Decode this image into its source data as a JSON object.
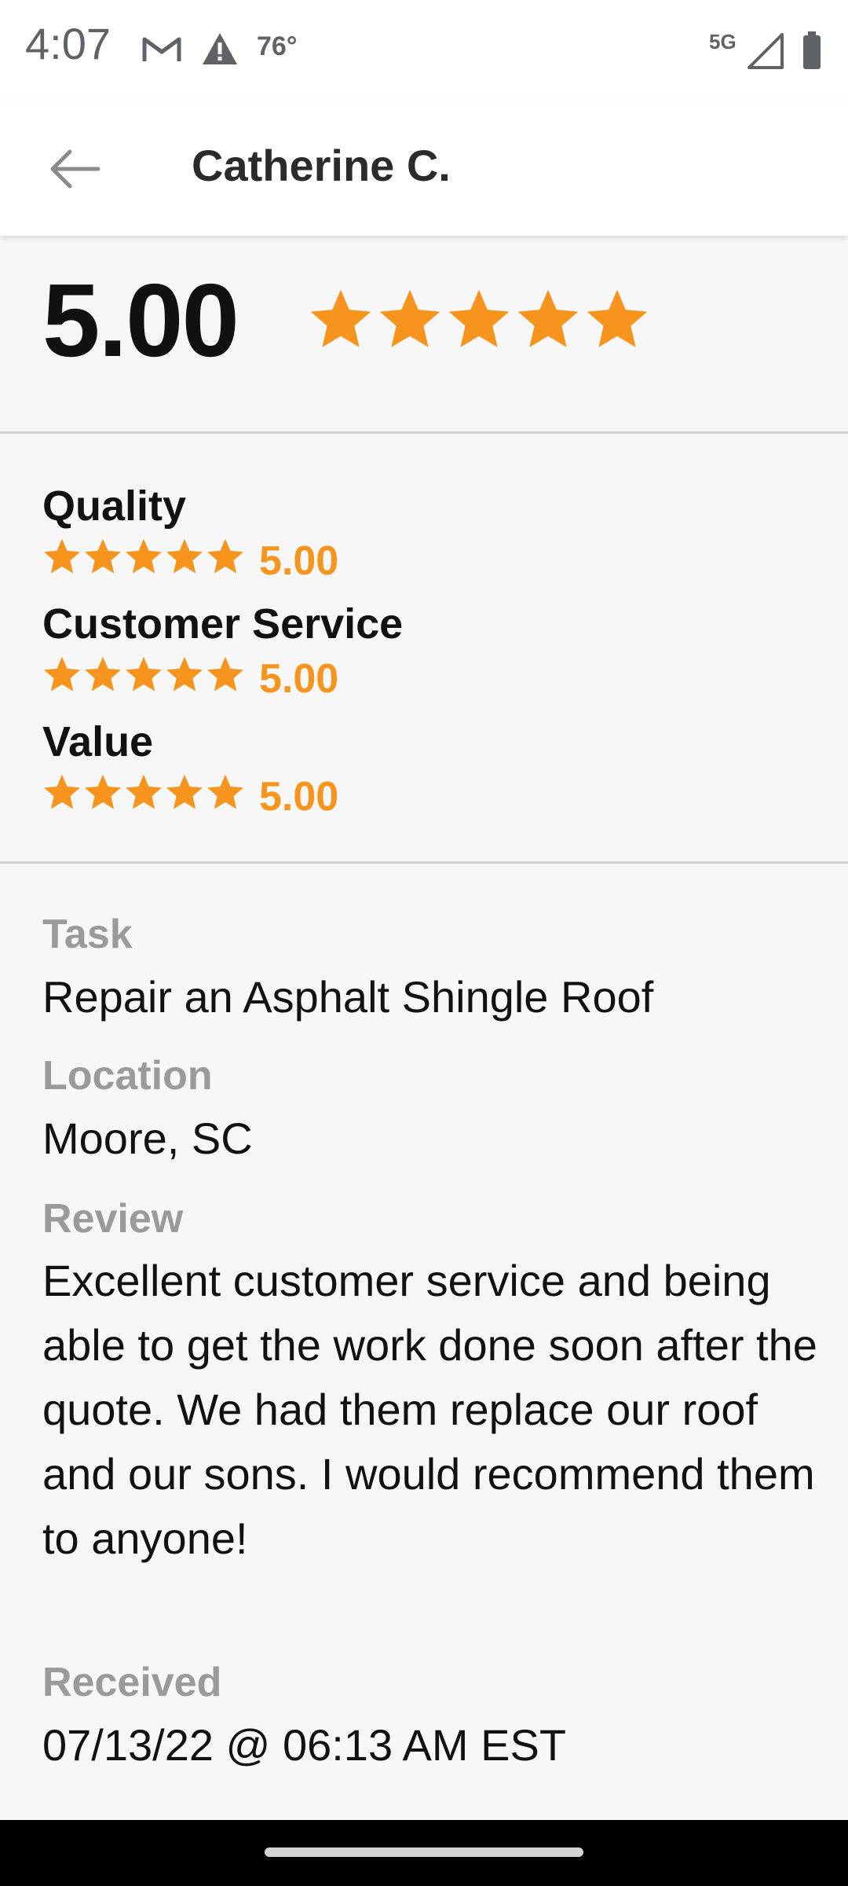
{
  "status_bar": {
    "time": "4:07",
    "temperature": "76°",
    "network": "5G",
    "icons": [
      "gmail-icon",
      "alert-icon",
      "signal-icon",
      "battery-icon"
    ]
  },
  "app_bar": {
    "title": "Catherine C.",
    "back_icon": "arrow-back-icon"
  },
  "overall": {
    "value": "5.00",
    "rating": 5,
    "max_rating": 5
  },
  "subratings": [
    {
      "label": "Quality",
      "value": "5.00",
      "rating": 5
    },
    {
      "label": "Customer Service",
      "value": "5.00",
      "rating": 5
    },
    {
      "label": "Value",
      "value": "5.00",
      "rating": 5
    }
  ],
  "details": {
    "task_label": "Task",
    "task": "Repair an Asphalt Shingle Roof",
    "location_label": "Location",
    "location": "Moore, SC",
    "review_label": "Review",
    "review": "Excellent customer service and being able to get the work done soon after the quote. We had them replace our roof and our sons. I would recommend them to anyone!",
    "received_label": "Received",
    "received": "07/13/22 @ 06:13 AM EST"
  },
  "colors": {
    "star": "#f7941d",
    "label_gray": "#9a9a9a",
    "background": "#f7f7f7"
  }
}
